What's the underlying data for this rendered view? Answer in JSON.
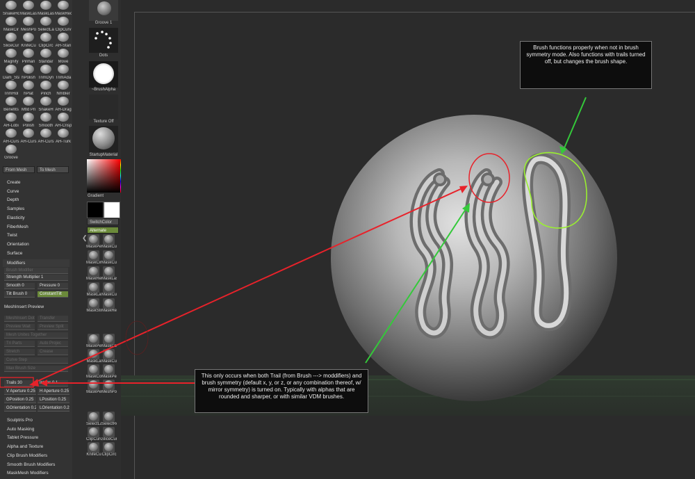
{
  "brush_palette": {
    "rows": [
      [
        "SnakeHo",
        "MaskLas",
        "MaskLas",
        "MaskRect"
      ],
      [
        "MaskCir",
        "MeshPo",
        "SelectLa",
        "ClipCurv"
      ],
      [
        "SliceCur",
        "KnifeCu",
        "ClipCirc",
        "AH-Stan"
      ],
      [
        "Magnify",
        "Pinhan",
        "Standar",
        "Move"
      ],
      [
        "Dam_Sta",
        "hPolish",
        "TrimDyn",
        "TrimAda"
      ],
      [
        "TrimHol",
        "hPlat",
        "Pinch",
        "Nmbler"
      ],
      [
        "Benefits",
        "Mtld Pri",
        "SnakeH",
        "AH-Drag"
      ],
      [
        "AH-Lobi",
        "Polish",
        "Smooth",
        "AH-Crisp"
      ],
      [
        "AH-Curs",
        "AH-Curs",
        "AH-Curs",
        "AH-Turk"
      ],
      [
        "Groove",
        "",
        "",
        ""
      ]
    ],
    "selected_name": "Groove",
    "from_mesh": "From Mesh",
    "to_mesh": "To Mesh"
  },
  "brush_menu": {
    "items": [
      "Create",
      "Curve",
      "Depth",
      "Samples",
      "Elasticity",
      "FiberMesh",
      "Twist",
      "Orientation",
      "Surface"
    ],
    "modifiers_header": "Modifiers",
    "brush_modifier": "Brush Modifier",
    "strength_multiplier": "Strength Multiplier 1",
    "smooth": "Smooth 0",
    "pressure": "Pressure 0",
    "tilt_brush": "Tilt Brush 0",
    "constant_tilt": "ConstantTilt",
    "mesh_insert_preview": "MeshInsert Preview",
    "dim_rows": [
      [
        "MeshInsert Dot",
        "Transfer"
      ],
      [
        "Preview Wait",
        "Preview Split"
      ],
      [
        "Mesh Unites Together",
        ""
      ],
      [
        "Tri Parts",
        "Auto Projec"
      ],
      [
        "Stretch",
        "Crease"
      ],
      [
        "Curve Step",
        ""
      ],
      [
        "Max Brush Size",
        ""
      ]
    ],
    "trails": "Trails 30",
    "intensity": "Intens 0.1",
    "v_aperture": "V Aperture 0.25",
    "h_aperture": "H Aperture 0.25",
    "g_position": "GPosition 0.25",
    "l_position": "LPosition 0.25",
    "g_orientation": "GOrientation 0.2",
    "l_orientation": "LOrientation 0.2",
    "bottom_items": [
      "Sculptris Pro",
      "Auto Masking",
      "Tablet Pressure",
      "Alpha and Texture",
      "Clip Brush Modifiers",
      "Smooth Brush Modifiers",
      "MaskMesh Modifiers"
    ]
  },
  "shelf": {
    "groove_label": "Groove 1",
    "dots_label": "Dots",
    "alpha_label": "~BrushAlpha",
    "texture_label": "Texture Off",
    "material_label": "StartupMaterial",
    "gradient_label": "Gradient",
    "switch_color": "SwitchColor",
    "alternate": "Alternate",
    "mask_icons": [
      [
        "MaskPe",
        "MaskCur"
      ],
      [
        "MaskCir",
        "MaskCur"
      ],
      [
        "MaskRe",
        "MaskLas"
      ],
      [
        "MaskLa",
        "MaskCut"
      ],
      [
        "MaskSti",
        "MaskRec"
      ]
    ],
    "lower_icons": [
      [
        "MaskPe",
        "MaskCo"
      ],
      [
        "MaskLa",
        "MaskCur"
      ],
      [
        "MaskCo",
        "MaskPe"
      ],
      [
        "MaskPe",
        "MeshPo"
      ]
    ],
    "bottom_icons": [
      [
        "SelectLa",
        "SelectRe"
      ],
      [
        "ClipCurv",
        "SliceCur"
      ],
      [
        "KnifeCu",
        "ClipCirc"
      ]
    ]
  },
  "callouts": {
    "top": "Brush functions properly when not in brush symmetry mode. Also functions with trails turned off, but changes the brush shape.",
    "bottom": "This only occurs when both Trail (from Brush ---> moddifiers) and brush symmetry (default x, y, or z, or any combination thereof, w/ mirror symmetry) is turned on. Typically with alphas that are rounded and sharper, or with similar VDM brushes."
  },
  "colors": {
    "annotation_red": "#e8222a",
    "annotation_green": "#34c93a",
    "highlight_green": "#9af030",
    "panel_bg": "#333333",
    "slider_green": "#6b8a3a"
  }
}
